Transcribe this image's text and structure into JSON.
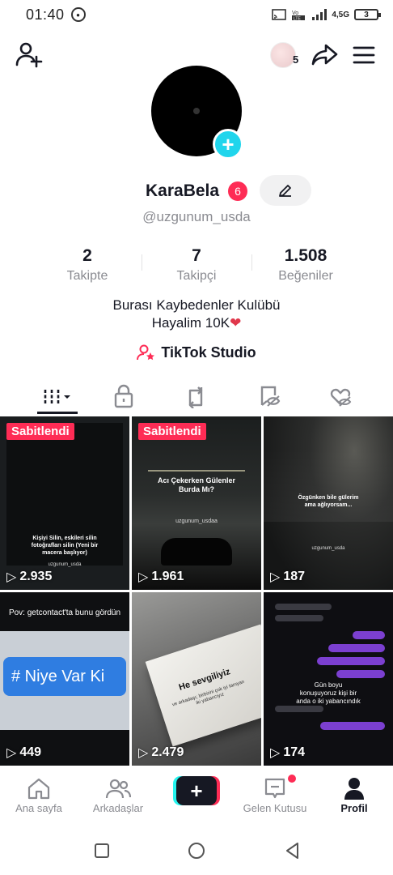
{
  "status_bar": {
    "time": "01:40",
    "network": "4,5G",
    "battery": "3"
  },
  "header": {
    "notification_count": "5"
  },
  "profile": {
    "display_name": "KaraBela",
    "badge_count": "6",
    "username": "@uzgunum_usda",
    "stats": [
      {
        "value": "2",
        "label": "Takipte"
      },
      {
        "value": "7",
        "label": "Takipçi"
      },
      {
        "value": "1.508",
        "label": "Beğeniler"
      }
    ],
    "bio_line1": "Burası Kaybedenler Kulübü",
    "bio_line2": "Hayalim 10K",
    "studio_label": "TikTok Studio"
  },
  "videos": [
    {
      "pinned_label": "Sabitlendi",
      "views": "2.935",
      "caption": "Kişiyi Silin, eskileri silin fotoğrafları silin (Yeni bir macera başlıyor)",
      "tag": "uzgunum_usda"
    },
    {
      "pinned_label": "Sabitlendi",
      "views": "1.961",
      "caption": "Acı Çekerken Gülenler Burda Mı?",
      "tag": "uzgunum_usdaa"
    },
    {
      "views": "187",
      "caption": "Özgünken bile gülerim ama ağlıyorsam...",
      "tag": "uzgunum_usda"
    },
    {
      "views": "449",
      "caption": "Pov: getcontact'ta bunu gördün",
      "chip": "# Niye Var Ki"
    },
    {
      "views": "2.479",
      "caption": "He sevgiliyiz",
      "subcaption": "ve arkadaşı; birbirini çok iyi tanıyan iki yabancıyız"
    },
    {
      "views": "174",
      "caption": "Gün boyu konuşuyoruz kişi bir anda o iki yabancındık"
    }
  ],
  "bottom_nav": {
    "home": "Ana sayfa",
    "friends": "Arkadaşlar",
    "inbox": "Gelen Kutusu",
    "profile": "Profil"
  },
  "colors": {
    "accent": "#fe2c55",
    "cyan": "#25f4ee",
    "text": "#161823",
    "secondary": "#8a8b91"
  }
}
